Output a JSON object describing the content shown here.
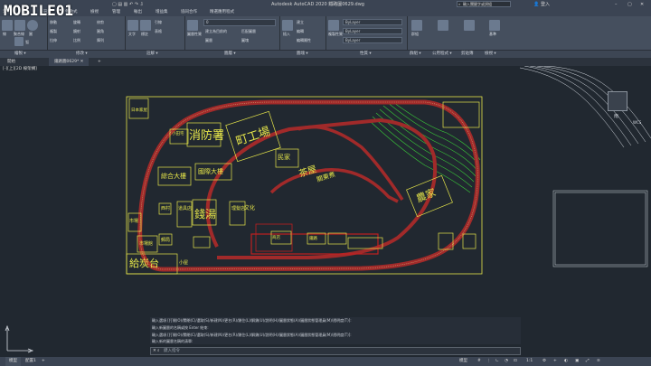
{
  "app": {
    "title": "Autodesk AutoCAD 2020  鐵路圖0629.dwg",
    "search_placeholder": "輸入關鍵字或詞組",
    "user": "登入",
    "watermark": "MOBILE01"
  },
  "ribbon_tabs": [
    "常用",
    "插入",
    "註解",
    "參數式",
    "檢視",
    "管理",
    "輸出",
    "增益集",
    "協同合作",
    "精選應用程式"
  ],
  "ribbon": {
    "draw": {
      "tools": [
        "線",
        "聚合線",
        "圓",
        "弧"
      ],
      "extra": [
        "移動",
        "旋轉",
        "修剪",
        "複製",
        "鏡射",
        "圓角",
        "拉伸",
        "比例",
        "陣列"
      ]
    },
    "annotation": {
      "text": "文字",
      "dimension": "標註",
      "leader": "引線",
      "table": "表格"
    },
    "layers": {
      "button": "圖層性質",
      "combo": "0",
      "items": [
        "建立為目前的",
        "匹配圖層",
        "圖層",
        "圖塊"
      ]
    },
    "block": {
      "insert": "插入",
      "create": "建立",
      "edit": "編輯",
      "attribute": "編輯屬性"
    },
    "properties": {
      "match": "複製性質",
      "color": "ByLayer",
      "linetype": "ByLayer",
      "lineweight": "ByLayer"
    },
    "groups_btn": "群組",
    "utilities": "公用程式",
    "clipboard": "剪貼簿",
    "base": "基準"
  },
  "ribbon_group_labels": [
    "繪製 ▾",
    "修改 ▾",
    "註解 ▾",
    "圖層 ▾",
    "圖塊 ▾",
    "性質 ▾",
    "群組 ▾",
    "公用程式 ▾",
    "剪貼簿",
    "檢視 ▾"
  ],
  "doc_tabs": {
    "start": "開始",
    "drawing": "鐵路圖0629*",
    "view_ctrl": "[-][上][2D 線架構]"
  },
  "drawing_labels": {
    "l1": "消防署",
    "l2": "町工場",
    "l3": "綜合大樓",
    "l4": "國際大樓",
    "l5": "錢湯",
    "l6": "給炭台",
    "l7": "農家",
    "l8": "茶屋",
    "l9": "關東煮",
    "l10": "小屋",
    "l11": "商店",
    "l12": "市場",
    "l13": "日本家屋",
    "l14": "民家",
    "l15": "理髮店",
    "l16": "文化",
    "l17": "市場館",
    "l18": "郵局",
    "l19": "鐵路",
    "l20": "西村",
    "l21": "小田宅",
    "l22": "道具店"
  },
  "view_cube": {
    "label": "南",
    "wcs": "WCS"
  },
  "command": {
    "line1": "輸入選項 [打開(O)/關閉(C)/選取(S)/新建(N)/更名(R)/鎖住(L)/解鎖(U)/說明(H)/圖層狀態(A)/圖層狀態管理員(M)/透明度(T)]:",
    "line2": "輸入選項 [打開(O)/關閉(C)/選取(S)/新建(N)/更名(R)/鎖住(L)/解鎖(U)/說明(H)/圖層狀態(A)/圖層狀態管理員(M)/透明度(T)]:",
    "line3": "輸入新圖層的名稱或按 Enter 結束:",
    "line4": "輸入新的圖層名稱的清單:",
    "prompt": "鍵入指令"
  },
  "status": {
    "model": "模型",
    "layout1": "配置1",
    "zoom": "1:1",
    "coords": "模型"
  },
  "colors": {
    "track": "#a12a2a",
    "building": "#e6e64a",
    "terrain": "#39c939",
    "canvas": "#212830"
  }
}
